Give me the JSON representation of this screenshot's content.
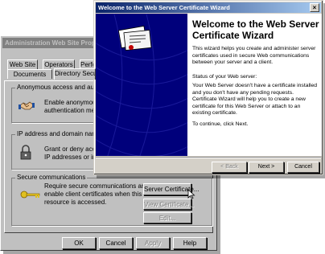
{
  "properties_dialog": {
    "title": "Administration Web Site Properties",
    "tabs_row1": [
      "Web Site",
      "Operators",
      "Perfo"
    ],
    "tabs_row2": [
      "Documents",
      "Directory Securit"
    ],
    "anonymous": {
      "title": "Anonymous access and authenticat",
      "text": "Enable anonymous acc\nauthentication method"
    },
    "ip": {
      "title": "IP address and domain name restricti",
      "text": "Grant or deny access t\nIP addresses or interne"
    },
    "secure": {
      "title": "Secure communications",
      "text": "Require secure communications and\nenable client certificates when this\nresource is accessed.",
      "server_cert_label": "Server Certificate...",
      "view_cert_label": "View Certificate...",
      "edit_label": "Edit..."
    },
    "buttons": {
      "ok": "OK",
      "cancel": "Cancel",
      "apply": "Apply",
      "help": "Help"
    }
  },
  "wizard": {
    "title": "Welcome to the Web Server Certificate Wizard",
    "close_glyph": "×",
    "heading": "Welcome to the Web Server Certificate Wizard",
    "intro": "This wizard helps you create and administer server certificates used in secure Web communications between your server and a client.",
    "status_label": "Status of your Web server:",
    "status_text": "Your Web Server doesn't have a certificate installed and you don't have any pending requests. Certificate Wizard will help you to create a new certificate for this Web Server or attach to an existing certificate.",
    "continue_text": "To continue, click Next.",
    "buttons": {
      "back": "< Back",
      "next": "Next >",
      "cancel": "Cancel"
    }
  },
  "colors": {
    "banner": "#00007b",
    "titlebar_active": "#0a246a",
    "titlebar_inactive": "#808080"
  }
}
